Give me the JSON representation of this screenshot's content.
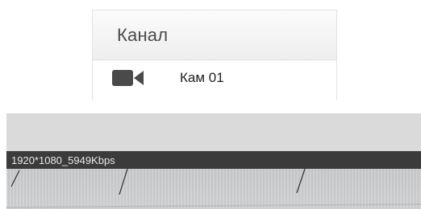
{
  "channel_list": {
    "header": "Канал",
    "items": [
      {
        "label": "Кам 01",
        "icon": "video-camera-icon"
      }
    ]
  },
  "video": {
    "stream_info": "1920*1080_5949Kbps"
  },
  "colors": {
    "info_bar": "#3b3b3b",
    "camera_icon": "#4a4a4a"
  }
}
